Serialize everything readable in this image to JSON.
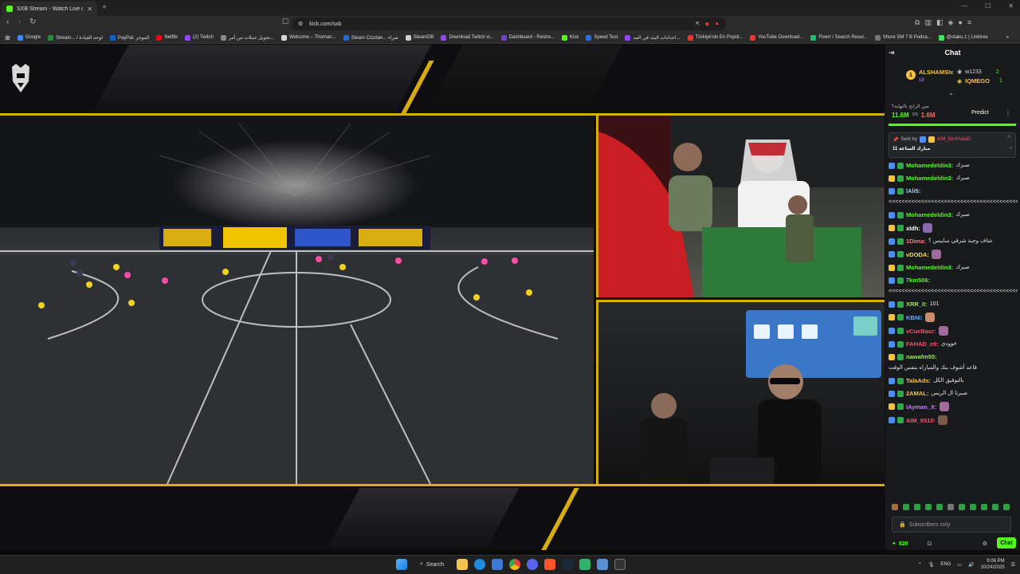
{
  "browser": {
    "tab_title": "SXB Stream - Watch Live on K",
    "url": "kick.com/sxb",
    "bookmarks": [
      {
        "label": "Google",
        "color": "#4285f4"
      },
      {
        "label": "Stream... / لوحة القيادة",
        "color": "#2b8a3e"
      },
      {
        "label": "PayPal: الموجز",
        "color": "#0a63c9"
      },
      {
        "label": "Netflix",
        "color": "#e50914"
      },
      {
        "label": "(2) Twitch",
        "color": "#9146ff"
      },
      {
        "label": "تحويل عملات من أمر...",
        "color": "#888888"
      },
      {
        "label": "Welcome – Thoman...",
        "color": "#d4d4d4"
      },
      {
        "label": "Steam Cüzdan... شراء",
        "color": "#1b6fd1"
      },
      {
        "label": "SteamDB",
        "color": "#cfcfcf"
      },
      {
        "label": "Download Twitch vi...",
        "color": "#9146ff"
      },
      {
        "label": "Dashboard - Restre...",
        "color": "#6f42c1"
      },
      {
        "label": "Kick",
        "color": "#53fc18"
      },
      {
        "label": "Speed Test",
        "color": "#1f6feb"
      },
      {
        "label": "اعدادات البث في المد...",
        "color": "#9146ff"
      },
      {
        "label": "Türkiye'nin En Popül...",
        "color": "#e33"
      },
      {
        "label": "YouTube Download...",
        "color": "#e33"
      },
      {
        "label": "Fiverr / Search Resul...",
        "color": "#1dbf73"
      },
      {
        "label": "Shure SM 7 B Podca...",
        "color": "#777"
      },
      {
        "label": "@otaku.1 | Linktree",
        "color": "#43e660"
      }
    ]
  },
  "chat": {
    "title": "Chat",
    "leaders": [
      {
        "name": "ALSHAMSIx",
        "count": "18",
        "color": "#f5c242"
      },
      {
        "name": "w1233",
        "count": "2",
        "color": "#cccccc"
      },
      {
        "name": "IQMEGO",
        "count": "1",
        "color": "#f5c242"
      }
    ],
    "prediction": {
      "question": "مين الرابح بالنهاية؟",
      "left": "11.6M",
      "vs": "vs",
      "right": "1.6M",
      "button": "Predict"
    },
    "pinned": {
      "sent_by": "Sent by",
      "sender": "AIM_BinKhalaD",
      "text": "مبارك الساعة 11"
    },
    "messages": [
      {
        "user": "Mohamedeldin3:",
        "color": "#53fc18",
        "text": "صبرك"
      },
      {
        "user": "Mohamedeldin3:",
        "color": "#53fc18",
        "text": "صبرك"
      },
      {
        "user": "lAli5:",
        "color": "#9ad0ff",
        "text": "<<<<<<<<<<<<<<<<<<<<<<<<<<<<<<<<<<<<<<<<<"
      },
      {
        "user": "Mohamedeldin3:",
        "color": "#53fc18",
        "text": "صبرك"
      },
      {
        "user": "xldh:",
        "color": "#ffffff",
        "text": ""
      },
      {
        "user": "1Dima:",
        "color": "#ff7a7a",
        "text": "شاف وجبة شرقي سايبس ؟"
      },
      {
        "user": "vDODA:",
        "color": "#ffde59",
        "text": ""
      },
      {
        "user": "Mohamedeldin3:",
        "color": "#53fc18",
        "text": "صبرك"
      },
      {
        "user": "7km506:",
        "color": "#53fc18",
        "text": "<<<<<<<<<<<<<<<<<<<<<<<<<<<<<<<<<<<<<<<<<"
      },
      {
        "user": "XRR_0:",
        "color": "#9be564",
        "text": "101"
      },
      {
        "user": "KBNI:",
        "color": "#6aa9ff",
        "text": ""
      },
      {
        "user": "vCueBasr:",
        "color": "#ff4d6d",
        "text": ""
      },
      {
        "user": "FAHAD_e9:",
        "color": "#ff4d6d",
        "text": "خوودي"
      },
      {
        "user": "nawafm55:",
        "color": "#9be564",
        "text": "قاعد أشوف بنك والمباراه بنفس الوقت"
      },
      {
        "user": "TalaAds:",
        "color": "#f5c242",
        "text": "بالتوفيق الكل"
      },
      {
        "user": "2AMAL:",
        "color": "#f5c242",
        "text": "صبرتا ال الريس"
      },
      {
        "user": "IAyman_X:",
        "color": "#c77dff",
        "text": ""
      },
      {
        "user": "AIM_6510:",
        "color": "#ff4d6d",
        "text": ""
      }
    ],
    "input_placeholder": "Subscribers only",
    "points": "820",
    "send_label": "Chat"
  },
  "taskbar": {
    "search": "Search",
    "lang": "ENG",
    "time": "9:06 PM",
    "date": "10/24/2025"
  }
}
